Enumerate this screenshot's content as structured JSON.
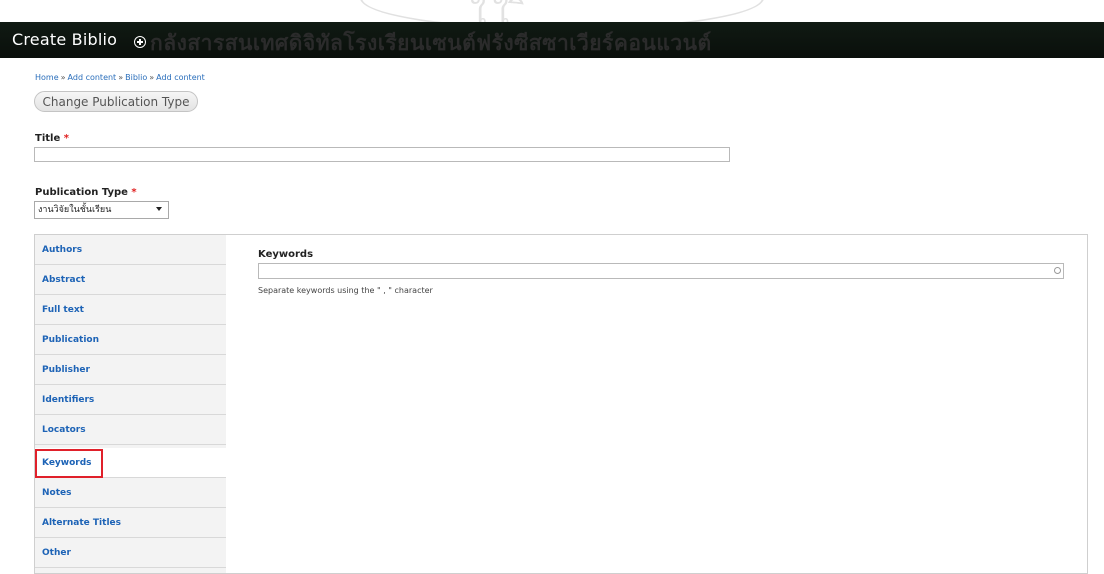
{
  "header": {
    "title": "Create Biblio",
    "watermark_text": "กลังสารสนเทศดิจิทัลโรงเรียนเซนต์ฟรังซีสซาเวียร์คอนแวนต์"
  },
  "breadcrumb": {
    "items": [
      "Home",
      "Add content",
      "Biblio",
      "Add content"
    ],
    "separator": "»"
  },
  "buttons": {
    "change_publication_type": "Change Publication Type"
  },
  "form": {
    "title_label": "Title",
    "title_value": "",
    "required_marker": "*",
    "publication_type_label": "Publication Type",
    "publication_type_selected": "งานวิจัยในชั้นเรียน"
  },
  "tabs": [
    {
      "label": "Authors",
      "active": false
    },
    {
      "label": "Abstract",
      "active": false
    },
    {
      "label": "Full text",
      "active": false
    },
    {
      "label": "Publication",
      "active": false
    },
    {
      "label": "Publisher",
      "active": false
    },
    {
      "label": "Identifiers",
      "active": false
    },
    {
      "label": "Locators",
      "active": false
    },
    {
      "label": "Keywords",
      "active": true
    },
    {
      "label": "Notes",
      "active": false
    },
    {
      "label": "Alternate Titles",
      "active": false
    },
    {
      "label": "Other",
      "active": false
    }
  ],
  "keywords_pane": {
    "label": "Keywords",
    "value": "",
    "description": "Separate keywords using the \" , \" character"
  },
  "colors": {
    "header_bg": "#0d130f",
    "link": "#2a6ebb",
    "tab_text": "#1d63b6",
    "required": "#e02020",
    "highlight_box": "#e0202a"
  }
}
